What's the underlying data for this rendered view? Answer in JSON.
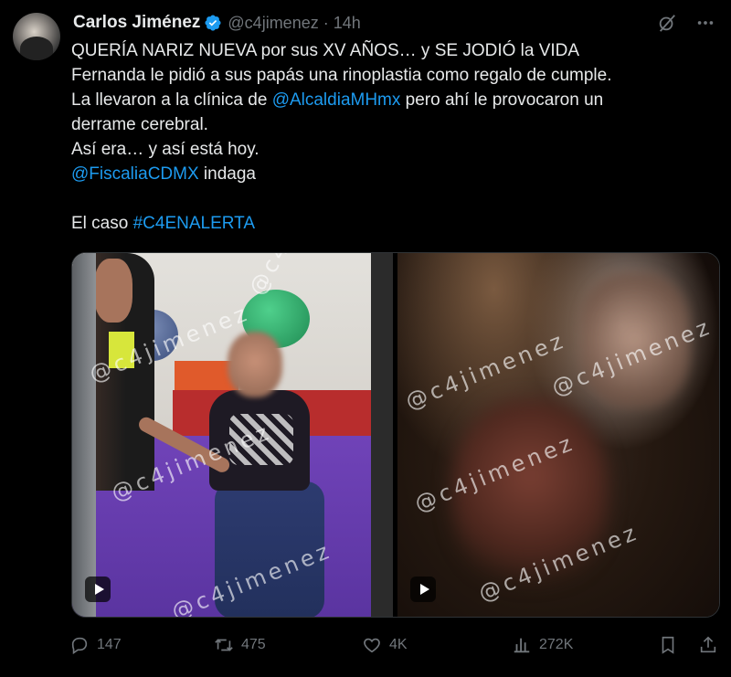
{
  "author": {
    "name": "Carlos Jiménez",
    "handle": "@c4jimenez",
    "separator": "·",
    "time": "14h",
    "verified": true,
    "avatar_icon": "avatar-photo"
  },
  "tweet": {
    "line1": "QUERÍA NARIZ NUEVA por sus XV AÑOS… y SE JODIÓ la VIDA",
    "line2": "Fernanda le pidió a sus papás una rinoplastia como regalo de cumple.",
    "line3_pre": "La llevaron a la clínica de ",
    "line3_mention": "@AlcaldiaMHmx",
    "line3_post": " pero ahí le provocaron un",
    "line4": "derrame cerebral.",
    "line5": "Así era… y así está hoy.",
    "line6_mention": "@FiscaliaCDMX",
    "line6_post": " indaga",
    "line8_pre": "El caso ",
    "line8_hashtag": "#C4ENALERTA"
  },
  "media": {
    "watermark": "@c4jimenez",
    "left_kind": "video",
    "right_kind": "video",
    "play_icon": "play-icon"
  },
  "actions": {
    "replies": "147",
    "retweets": "475",
    "likes": "4K",
    "views": "272K"
  },
  "colors": {
    "background": "#000000",
    "text": "#e7e9ea",
    "muted": "#71767b",
    "link": "#1d9bf0",
    "verified": "#1d9bf0"
  }
}
